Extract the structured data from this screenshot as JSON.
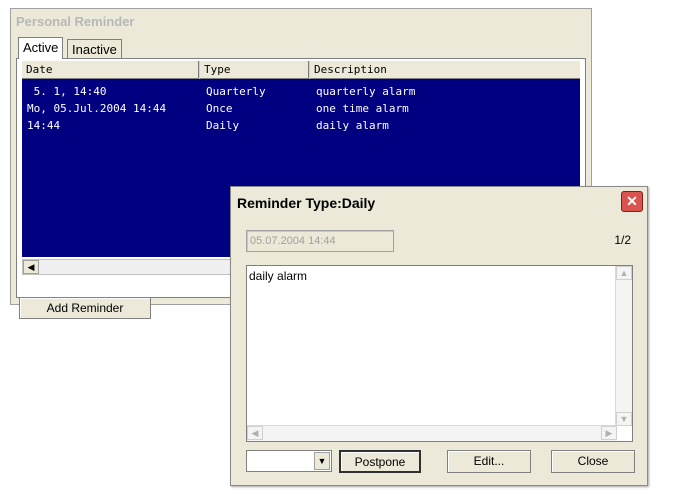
{
  "main_window": {
    "title": "Personal Reminder",
    "tabs": [
      {
        "label": "Active"
      },
      {
        "label": "Inactive"
      }
    ],
    "columns": [
      "Date",
      "Type",
      "Description"
    ],
    "rows": [
      {
        "date": " 5. 1, 14:40",
        "type": "Quarterly",
        "description": "quarterly alarm"
      },
      {
        "date": "Mo, 05.Jul.2004 14:44",
        "type": "Once",
        "description": "one time alarm"
      },
      {
        "date": "14:44",
        "type": "Daily",
        "description": "daily alarm"
      }
    ],
    "add_button_label": "Add Reminder"
  },
  "dialog": {
    "title": "Reminder Type:Daily",
    "close_glyph": "✕",
    "date_value": "05.07.2004 14:44",
    "page_indicator": "1/2",
    "text": "daily alarm",
    "postpone_label": "Postpone",
    "edit_label": "Edit...",
    "close_label": "Close"
  },
  "glyphs": {
    "left_arrow": "◀",
    "right_arrow": "▶",
    "up_arrow": "▲",
    "down_arrow": "▼"
  },
  "colors": {
    "list_selection": "#000080",
    "close_button": "#d9534f"
  }
}
